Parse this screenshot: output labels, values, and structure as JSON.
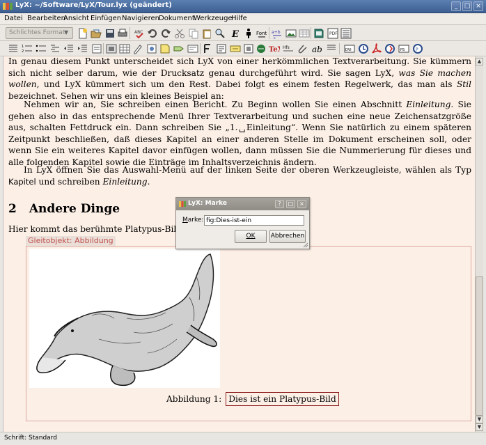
{
  "window": {
    "title": "LyX: ~/Software/LyX/Tour.lyx (geändert)"
  },
  "menu": {
    "items": [
      "Datei",
      "Bearbeiten",
      "Ansicht",
      "Einfügen",
      "Navigieren",
      "Dokument",
      "Werkzeuge",
      "Hilfe"
    ]
  },
  "toolbar": {
    "format_combo": "Schlichtes Format"
  },
  "document": {
    "p1_start": "In genau diesem Punkt unterscheidet sich LyX von einer herkömmlichen Textverarbeitung. Sie kümmern sich nicht selber darum, wie der Drucksatz genau durchgeführt wird. Sie sagen LyX, ",
    "p1_emph": "was Sie machen wollen",
    "p1_mid": ", und LyX kümmert sich um den Rest. Dabei folgt es einem festen Regelwerk, das man als ",
    "p1_stil": "Stil",
    "p1_end": " bezeichnet. Sehen wir uns ein kleines Beispiel an:",
    "p2_start": "Nehmen wir an, Sie schreiben einen Bericht. Zu Beginn wollen Sie einen Abschnitt ",
    "p2_emph": "Einleitung",
    "p2_end": ". Sie gehen also in das entsprechende Menü Ihrer Textverarbeitung und suchen eine neue Zeichensatzgröße aus, schalten Fettdruck ein. Dann schreiben Sie „1.␣Einleitung“. Wenn Sie natürlich zu einem späteren Zeitpunkt beschließen, daß dieses Kapitel an einer anderen Stelle im Dokument erscheinen soll, oder wenn Sie ein weiteres Kapitel davor einfügen wollen, dann müssen Sie die Nummerierung für dieses und alle folgenden Kapitel sowie die Einträge im Inhaltsverzeichnis ändern.",
    "p3_start": "In LyX öffnen Sie das Auswahl-Menü auf der linken Seite der oberen Werkzeugleiste, wählen als Typ ",
    "p3_kapitel": "Kapitel",
    "p3_mid": " und schreiben ",
    "p3_emph": "Einleitung",
    "p3_end": ".",
    "heading_num": "2",
    "heading_text": "Andere Dinge",
    "p4": "Hier kommt das berühmte Platypus-Bild:",
    "float_label": "Gleitobjekt: Abbildung",
    "caption_label": "Abbildung 1:",
    "caption_text": "Dies ist ein Platypus-Bild"
  },
  "status": {
    "text": "Schrift: Standard"
  },
  "dialog": {
    "title": "LyX: Marke",
    "label_prefix": "M",
    "label_rest": "arke:",
    "value": "fig:Dies-ist-ein",
    "ok": "OK",
    "cancel": "Abbrechen"
  },
  "colors": {
    "doc_bg": "#fcefe6",
    "float_label": "#c0504d",
    "caption_box": "#8b1a1a"
  }
}
